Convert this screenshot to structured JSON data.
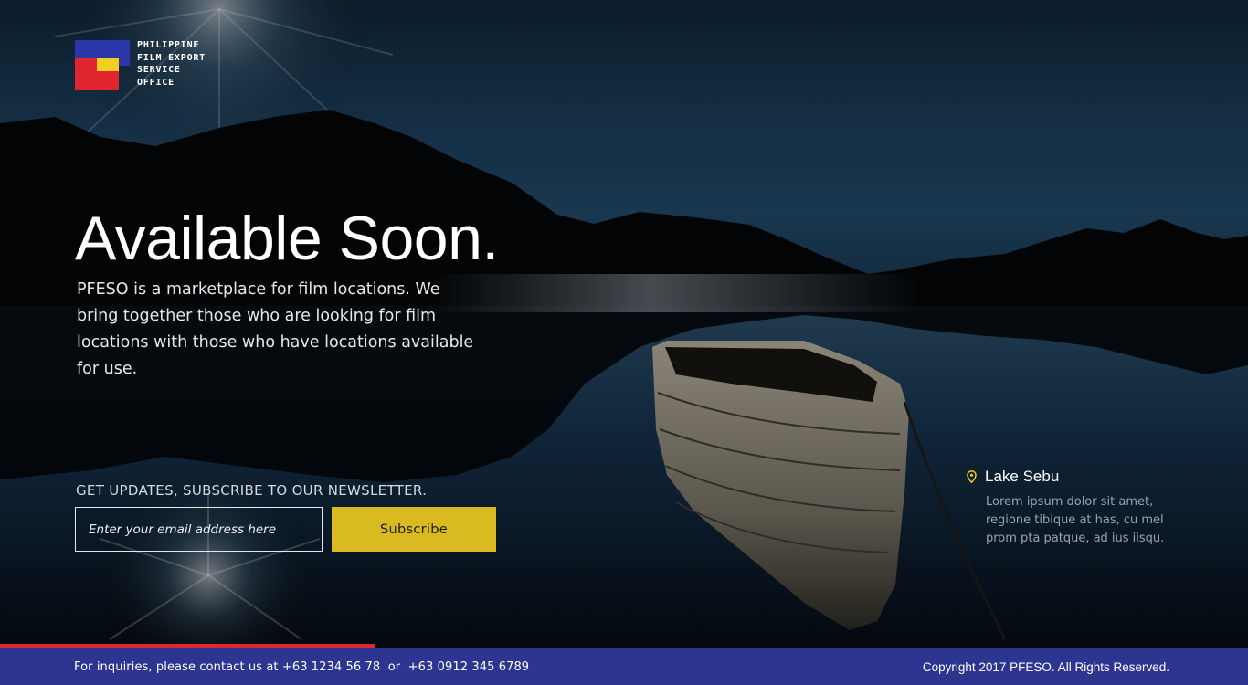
{
  "brand": {
    "logo_lines": [
      "PHILIPPINE",
      "FILM EXPORT",
      "SERVICE",
      "OFFICE"
    ],
    "colors": {
      "blue": "#2b37a8",
      "red": "#e1252f",
      "yellow": "#f2cf21"
    }
  },
  "hero": {
    "headline": "Available Soon.",
    "intro": "PFESO is a marketplace for film locations. We bring together those who are looking for film locations with those who have locations available for use."
  },
  "newsletter": {
    "label": "GET UPDATES, SUBSCRIBE TO OUR NEWSLETTER.",
    "email_placeholder": "Enter your email address here",
    "email_value": "",
    "subscribe_label": "Subscribe",
    "button_color": "#d9ba21"
  },
  "location": {
    "icon": "map-pin-icon",
    "name": "Lake Sebu",
    "description": "Lorem ipsum dolor sit amet, regione tibique at has, cu mel prom pta patque, ad ius iisqu."
  },
  "slideshow": {
    "progress": 0.3,
    "progress_color": "#e0262e"
  },
  "footer": {
    "contact": "For inquiries, please contact us at +63 1234 56 78  or  +63 0912 345 6789",
    "copyright": "Copyright 2017 PFESO. All Rights Reserved.",
    "background": "#2c3590"
  }
}
